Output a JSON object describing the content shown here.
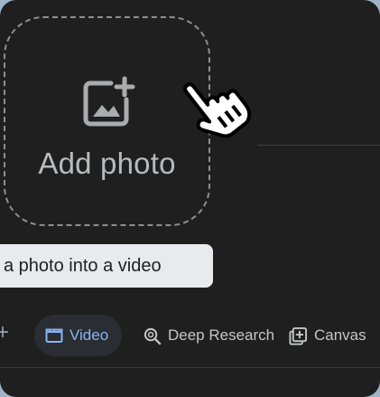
{
  "upload": {
    "label": "Add photo",
    "icon": "add-photo-icon"
  },
  "tooltip": {
    "text": "a photo into a video"
  },
  "toolbar": {
    "plus_icon": "plus-icon",
    "video_label": "Video",
    "video_icon": "clapperboard-icon",
    "deep_research_label": "Deep Research",
    "deep_research_icon": "deep-research-icon",
    "canvas_label": "Canvas",
    "canvas_icon": "canvas-icon"
  },
  "colors": {
    "background": "#1f1f20",
    "accent": "#8ab4f8",
    "tooltip_bg": "#e8eaed"
  }
}
